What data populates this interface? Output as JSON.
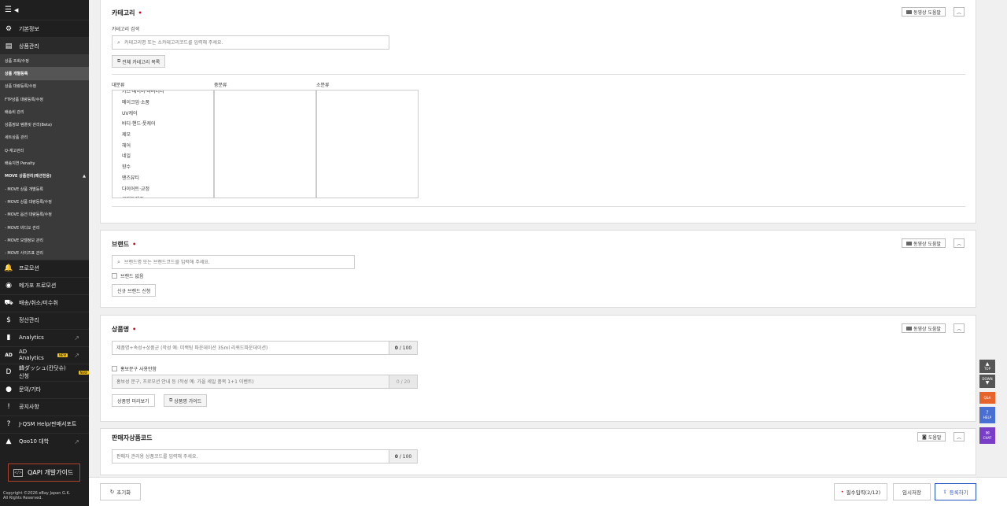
{
  "sidebar": {
    "menus_top": [
      {
        "label": "기본정보",
        "icon": "gear-icon",
        "glyph": "⚙"
      },
      {
        "label": "상품관리",
        "icon": "document-icon",
        "glyph": "▤"
      }
    ],
    "sub_items": [
      {
        "label": "상품 조회/수정",
        "active": false,
        "bold": false
      },
      {
        "label": "상품 개별등록",
        "active": true,
        "bold": true
      },
      {
        "label": "상품 대량등록/수정",
        "active": false,
        "bold": false
      },
      {
        "label": "FTP상품 대량등록/수정",
        "active": false,
        "bold": false
      },
      {
        "label": "배송비 관리",
        "active": false,
        "bold": false
      },
      {
        "label": "상품정보 템플릿 관리(Beta)",
        "active": false,
        "bold": false
      },
      {
        "label": "세트상품 관리",
        "active": false,
        "bold": false
      },
      {
        "label": "Q-재고관리",
        "active": false,
        "bold": false
      },
      {
        "label": "배송지연 Penalty",
        "active": false,
        "bold": false
      },
      {
        "label": "MOVE 상품관리(패션전용)",
        "active": false,
        "bold": true,
        "caret": "▲"
      },
      {
        "label": "- MOVE 상품 개별등록",
        "active": false,
        "bold": false
      },
      {
        "label": "- MOVE 상품 대량등록/수정",
        "active": false,
        "bold": false
      },
      {
        "label": "- MOVE 옵션 대량등록/수정",
        "active": false,
        "bold": false
      },
      {
        "label": "- MOVE 비디오 관리",
        "active": false,
        "bold": false
      },
      {
        "label": "- MOVE 모델정보 관리",
        "active": false,
        "bold": false
      },
      {
        "label": "- MOVE 사이즈표 관리",
        "active": false,
        "bold": false
      }
    ],
    "menus_bottom": [
      {
        "label": "프로모션",
        "icon": "bell-icon",
        "glyph": "🔔",
        "ext": ""
      },
      {
        "label": "메가포 프로모션",
        "icon": "mega-icon",
        "glyph": "◉",
        "ext": ""
      },
      {
        "label": "배송/취소/미수취",
        "icon": "truck-icon",
        "glyph": "⛟",
        "ext": ""
      },
      {
        "label": "정산관리",
        "icon": "money-icon",
        "glyph": "$",
        "ext": ""
      },
      {
        "label": "Analytics",
        "icon": "chart-icon",
        "glyph": "▮",
        "ext": "↗"
      },
      {
        "label": "AD Analytics",
        "icon": "ad-icon",
        "glyph": "AD",
        "ext": "↗",
        "badge": "NEW"
      },
      {
        "label": "韓ダッシュ(칸닷슈) 신청",
        "icon": "dash-icon",
        "glyph": "D",
        "ext": "",
        "badge": "NEW"
      },
      {
        "label": "문의/기타",
        "icon": "user-icon",
        "glyph": "●",
        "ext": ""
      },
      {
        "label": "공지사항",
        "icon": "notice-icon",
        "glyph": "!",
        "ext": ""
      },
      {
        "label": "J-QSM Help/판매서포트",
        "icon": "help-icon",
        "glyph": "?",
        "ext": ""
      },
      {
        "label": "Qoo10 대학",
        "icon": "school-icon",
        "glyph": "▲",
        "ext": "↗"
      }
    ],
    "qapi_label": "QAPI 개발가이드",
    "qapi_icon_text": "</>",
    "copyright_line1": "Copyright ©2026 eBay Japan G.K.",
    "copyright_line2": "All Rights Reserved."
  },
  "category": {
    "title": "카테고리",
    "help_label": "동영상 도움말",
    "search_label": "카테고리 검색",
    "search_placeholder": "카테고리명 또는 소카테고리코드를 입력해 주세요.",
    "all_list_button": "전체 카테고리 목록",
    "col_large": "대분류",
    "col_medium": "중분류",
    "col_small": "소분류",
    "large_items": [
      "키즈·베이비·마터니티",
      "메이크업·소품",
      "UV케어",
      "바디·핸드·풋케어",
      "제모",
      "헤어",
      "네일",
      "향수",
      "맨즈뷰티",
      "다이어트·교정",
      "콘택트렌즈"
    ]
  },
  "brand": {
    "title": "브랜드",
    "help_label": "동영상 도움말",
    "search_placeholder": "브랜드명 또는 브랜드코드를 입력해 주세요.",
    "no_brand_label": "브랜드 없음",
    "new_brand_button": "신규 브랜드 신청"
  },
  "product_name": {
    "title": "상품명",
    "help_label": "동영상 도움말",
    "name_placeholder": "제품명+속성+상품군 (작성 예: 미백팅 파운데이션 35ml 리퀴드파운데이션)",
    "name_count": "0",
    "name_max": "100",
    "promo_checkbox_label": "홍보문구 사용안함",
    "promo_placeholder": "홍보성 문구, 프로모션 안내 등 (작성 예: 가을 세일 품목 1+1 이벤트)",
    "promo_counter": "0 / 20",
    "preview_button": "상품명 미리보기",
    "guide_button": "상품명 가이드"
  },
  "seller_code": {
    "title": "판매자상품코드",
    "help_label": "도움말",
    "placeholder": "판매자 관리용 상품코드를 입력해 주세요.",
    "count": "0",
    "max": "100"
  },
  "bottom": {
    "reset_label": "초기화",
    "required_label": "필수입력(2/12)",
    "temp_save_label": "임시저장",
    "register_label": "등록하기"
  },
  "float": {
    "top_label": "TOP",
    "down_label": "DOWN",
    "qa_label": "Q&A",
    "help_label": "HELP",
    "chat_label": "CHAT"
  },
  "colors": {
    "sidebar_bg": "#1f1f1f",
    "accent_blue": "#2a57c6",
    "required_red": "#d0021b",
    "qa_orange": "#e8622c",
    "help_blue": "#4a6fd4",
    "chat_purple": "#7a3dc8"
  }
}
